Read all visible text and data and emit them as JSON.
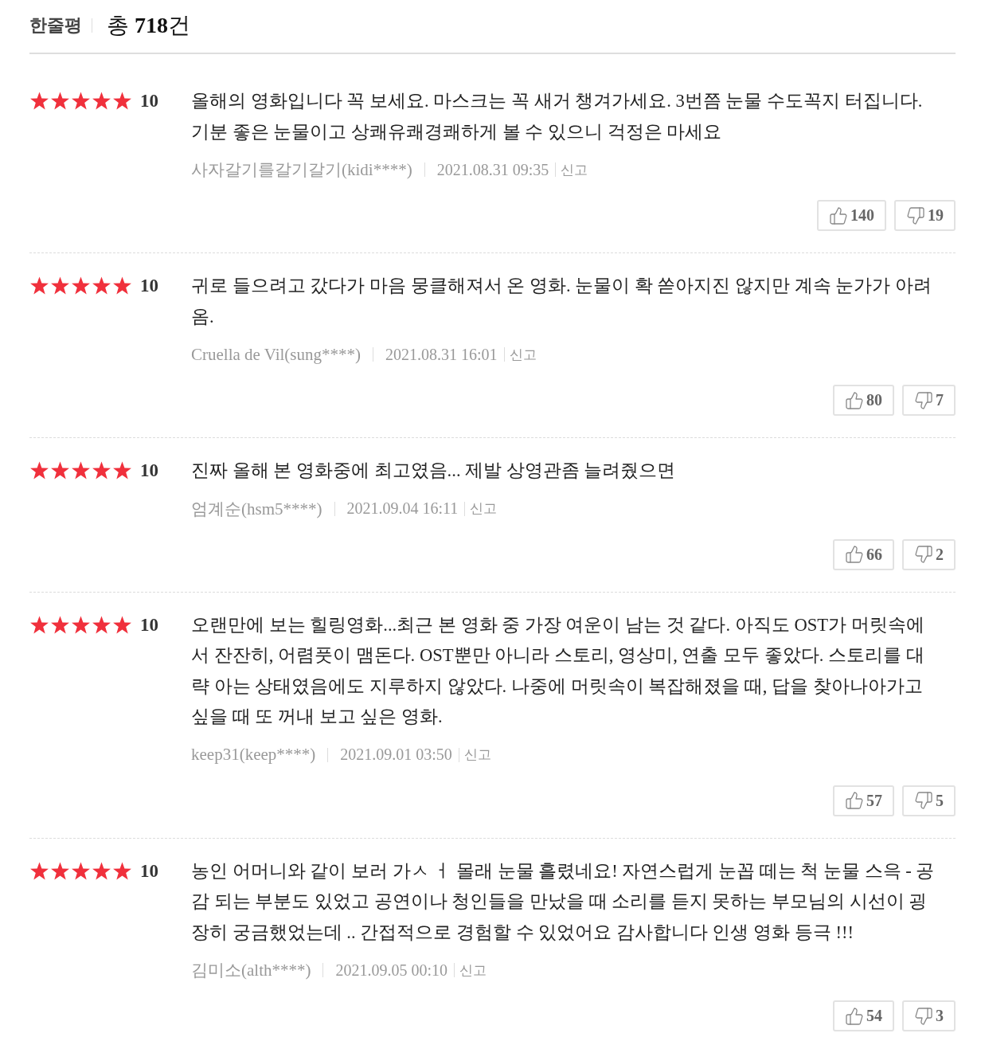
{
  "header": {
    "title": "한줄평",
    "total": "총 **718**건"
  },
  "reviews": [
    {
      "stars": 5,
      "score": "10",
      "text": "올해의 영화입니다 꼭 보세요. 마스크는 꼭 새거 챙겨가세요. 3번쯤 눈물 수도꼭지 터집니다. 기분 좋은 눈물이고 상쾌유쾌경쾌하게 볼 수 있으니 걱정은 마세요",
      "author": "사자갈기를갈기갈기(kidi****)",
      "date": "2021.08.31 09:35",
      "report": "신고",
      "likes": "140",
      "dislikes": "19"
    },
    {
      "stars": 5,
      "score": "10",
      "text": "귀로 들으려고 갔다가 마음 뭉클해져서 온 영화. 눈물이 확 쏟아지진 않지만 계속 눈가가 아려옴.",
      "author": "Cruella de Vil(sung****)",
      "date": "2021.08.31 16:01",
      "report": "신고",
      "likes": "80",
      "dislikes": "7"
    },
    {
      "stars": 5,
      "score": "10",
      "text": "진짜 올해 본 영화중에 최고였음... 제발 상영관좀 늘려줬으면",
      "author": "엄계순(hsm5****)",
      "date": "2021.09.04 16:11",
      "report": "신고",
      "likes": "66",
      "dislikes": "2"
    },
    {
      "stars": 5,
      "score": "10",
      "text": "오랜만에 보는 힐링영화...최근 본 영화 중 가장 여운이 남는 것 같다. 아직도 OST가 머릿속에서 잔잔히, 어렴풋이 맴돈다. OST뿐만 아니라 스토리, 영상미, 연출 모두 좋았다. 스토리를 대략 아는 상태였음에도 지루하지 않았다. 나중에 머릿속이 복잡해졌을 때, 답을 찾아나아가고 싶을 때 또 꺼내 보고 싶은 영화.",
      "author": "keep31(keep****)",
      "date": "2021.09.01 03:50",
      "report": "신고",
      "likes": "57",
      "dislikes": "5"
    },
    {
      "stars": 5,
      "score": "10",
      "text": "농인 어머니와 같이 보러 가ㅅ ㅓ 몰래 눈물 흘렸네요! 자연스럽게 눈꼽 떼는 척 눈물 스윽 - 공감 되는 부분도 있었고 공연이나 청인들을 만났을 때 소리를 듣지 못하는 부모님의 시선이 굉장히 궁금했었는데 .. 간접적으로 경험할 수 있었어요 감사합니다 인생 영화 등극 !!!",
      "author": "김미소(alth****)",
      "date": "2021.09.05 00:10",
      "report": "신고",
      "likes": "54",
      "dislikes": "3"
    }
  ]
}
